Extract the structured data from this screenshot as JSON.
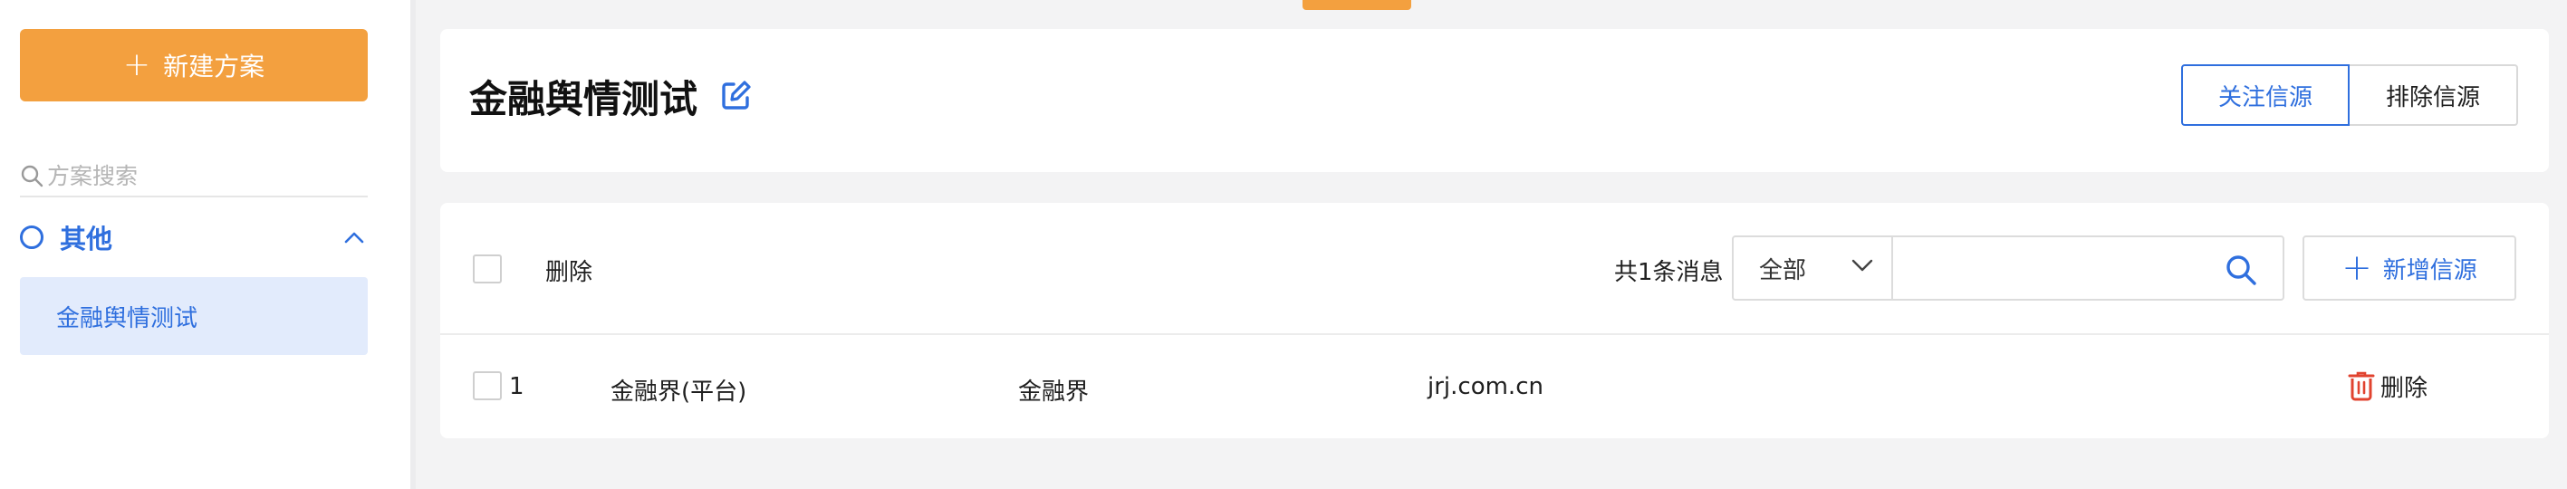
{
  "sidebar": {
    "new_plan_label": "新建方案",
    "search_placeholder": "方案搜索",
    "group": {
      "label": "其他"
    },
    "items": [
      {
        "label": "金融舆情测试"
      }
    ]
  },
  "header": {
    "title": "金融舆情测试",
    "tabs": [
      {
        "label": "关注信源"
      },
      {
        "label": "排除信源"
      }
    ]
  },
  "toolbar": {
    "delete_label": "删除",
    "total_text": "共1条消息",
    "filter": {
      "selected": "全部"
    },
    "search": {
      "value": "",
      "placeholder": ""
    },
    "add_label": "新增信源"
  },
  "rows": [
    {
      "index": "1",
      "name": "金融界(平台)",
      "site": "金融界",
      "domain": "jrj.com.cn",
      "delete_label": "删除"
    }
  ],
  "colors": {
    "accent_orange": "#f3a03f",
    "primary_blue": "#2f6fde",
    "danger_red": "#e1432f"
  }
}
